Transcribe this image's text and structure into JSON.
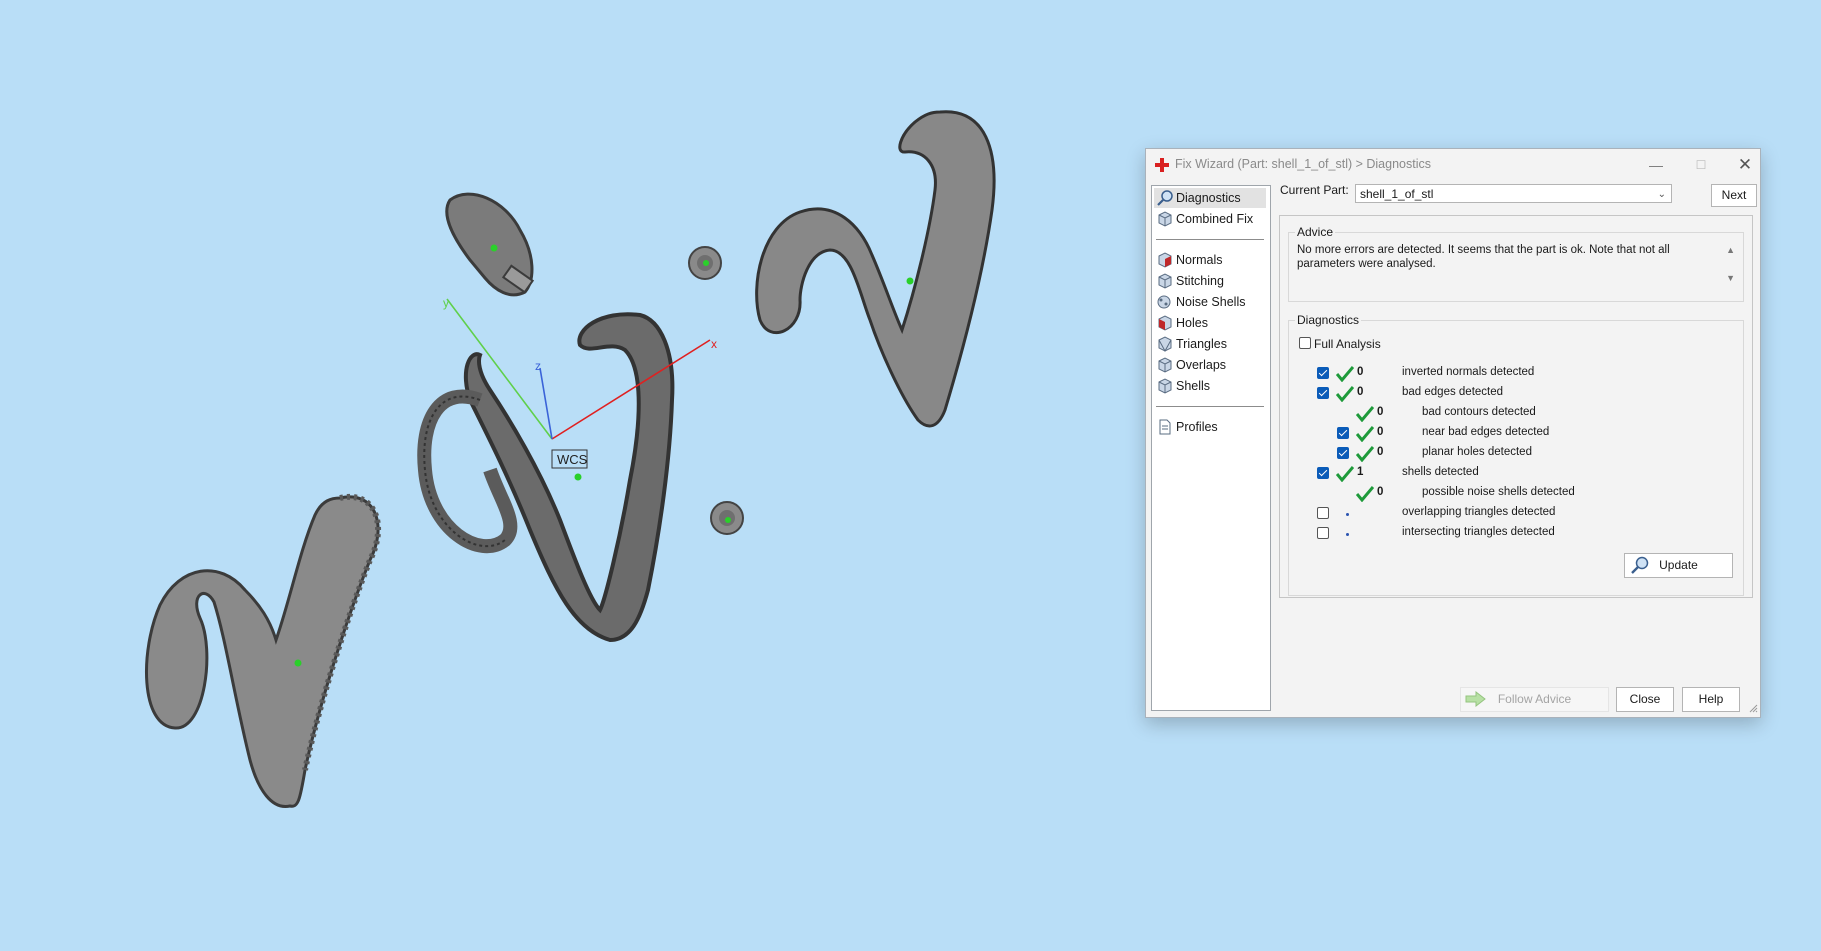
{
  "viewport": {
    "wcs_label": "WCS",
    "axis_x": "x",
    "axis_y": "y",
    "axis_z": "z"
  },
  "dialog": {
    "title": "Fix Wizard (Part: shell_1_of_stl) > Diagnostics",
    "nav_items": [
      {
        "label": "Diagnostics",
        "icon": "magnifier-icon"
      },
      {
        "label": "Combined Fix",
        "icon": "cube-icon"
      },
      {
        "label": "Normals",
        "icon": "normals-cube-icon"
      },
      {
        "label": "Stitching",
        "icon": "stitching-cube-icon"
      },
      {
        "label": "Noise Shells",
        "icon": "noise-shells-icon"
      },
      {
        "label": "Holes",
        "icon": "holes-cube-icon"
      },
      {
        "label": "Triangles",
        "icon": "triangles-cube-icon"
      },
      {
        "label": "Overlaps",
        "icon": "overlaps-cube-icon"
      },
      {
        "label": "Shells",
        "icon": "shells-cube-icon"
      },
      {
        "label": "Profiles",
        "icon": "document-icon"
      }
    ],
    "current_part_label": "Current Part:",
    "current_part_value": "shell_1_of_stl",
    "next_label": "Next",
    "advice_title": "Advice",
    "advice_text": "No more errors are detected. It seems that the part is ok. Note that not all parameters were analysed.",
    "diagnostics_title": "Diagnostics",
    "full_analysis_label": "Full Analysis",
    "full_analysis_checked": false,
    "rows": [
      {
        "checked": true,
        "status": "ok",
        "count": "0",
        "label": "inverted normals detected",
        "indent": 0
      },
      {
        "checked": true,
        "status": "ok",
        "count": "0",
        "label": "bad edges detected",
        "indent": 0
      },
      {
        "checked": null,
        "status": "ok",
        "count": "0",
        "label": "bad contours detected",
        "indent": 1
      },
      {
        "checked": true,
        "status": "ok",
        "count": "0",
        "label": "near bad edges detected",
        "indent": 1
      },
      {
        "checked": true,
        "status": "ok",
        "count": "0",
        "label": "planar holes detected",
        "indent": 1
      },
      {
        "checked": true,
        "status": "ok",
        "count": "1",
        "label": "shells detected",
        "indent": 0
      },
      {
        "checked": null,
        "status": "ok",
        "count": "0",
        "label": "possible noise shells detected",
        "indent": 1
      },
      {
        "checked": false,
        "status": "not-run",
        "count": "",
        "label": "overlapping triangles detected",
        "indent": 0
      },
      {
        "checked": false,
        "status": "not-run",
        "count": "",
        "label": "intersecting triangles detected",
        "indent": 0
      }
    ],
    "update_label": "Update",
    "follow_advice_label": "Follow Advice",
    "close_label": "Close",
    "help_label": "Help"
  },
  "colors": {
    "background": "#b9def7",
    "check_green": "#1e9a3a",
    "checkbox_blue": "#0a5bb8",
    "axis_x": "#e02020",
    "axis_y": "#5fd04a",
    "axis_z": "#3a63d8"
  }
}
